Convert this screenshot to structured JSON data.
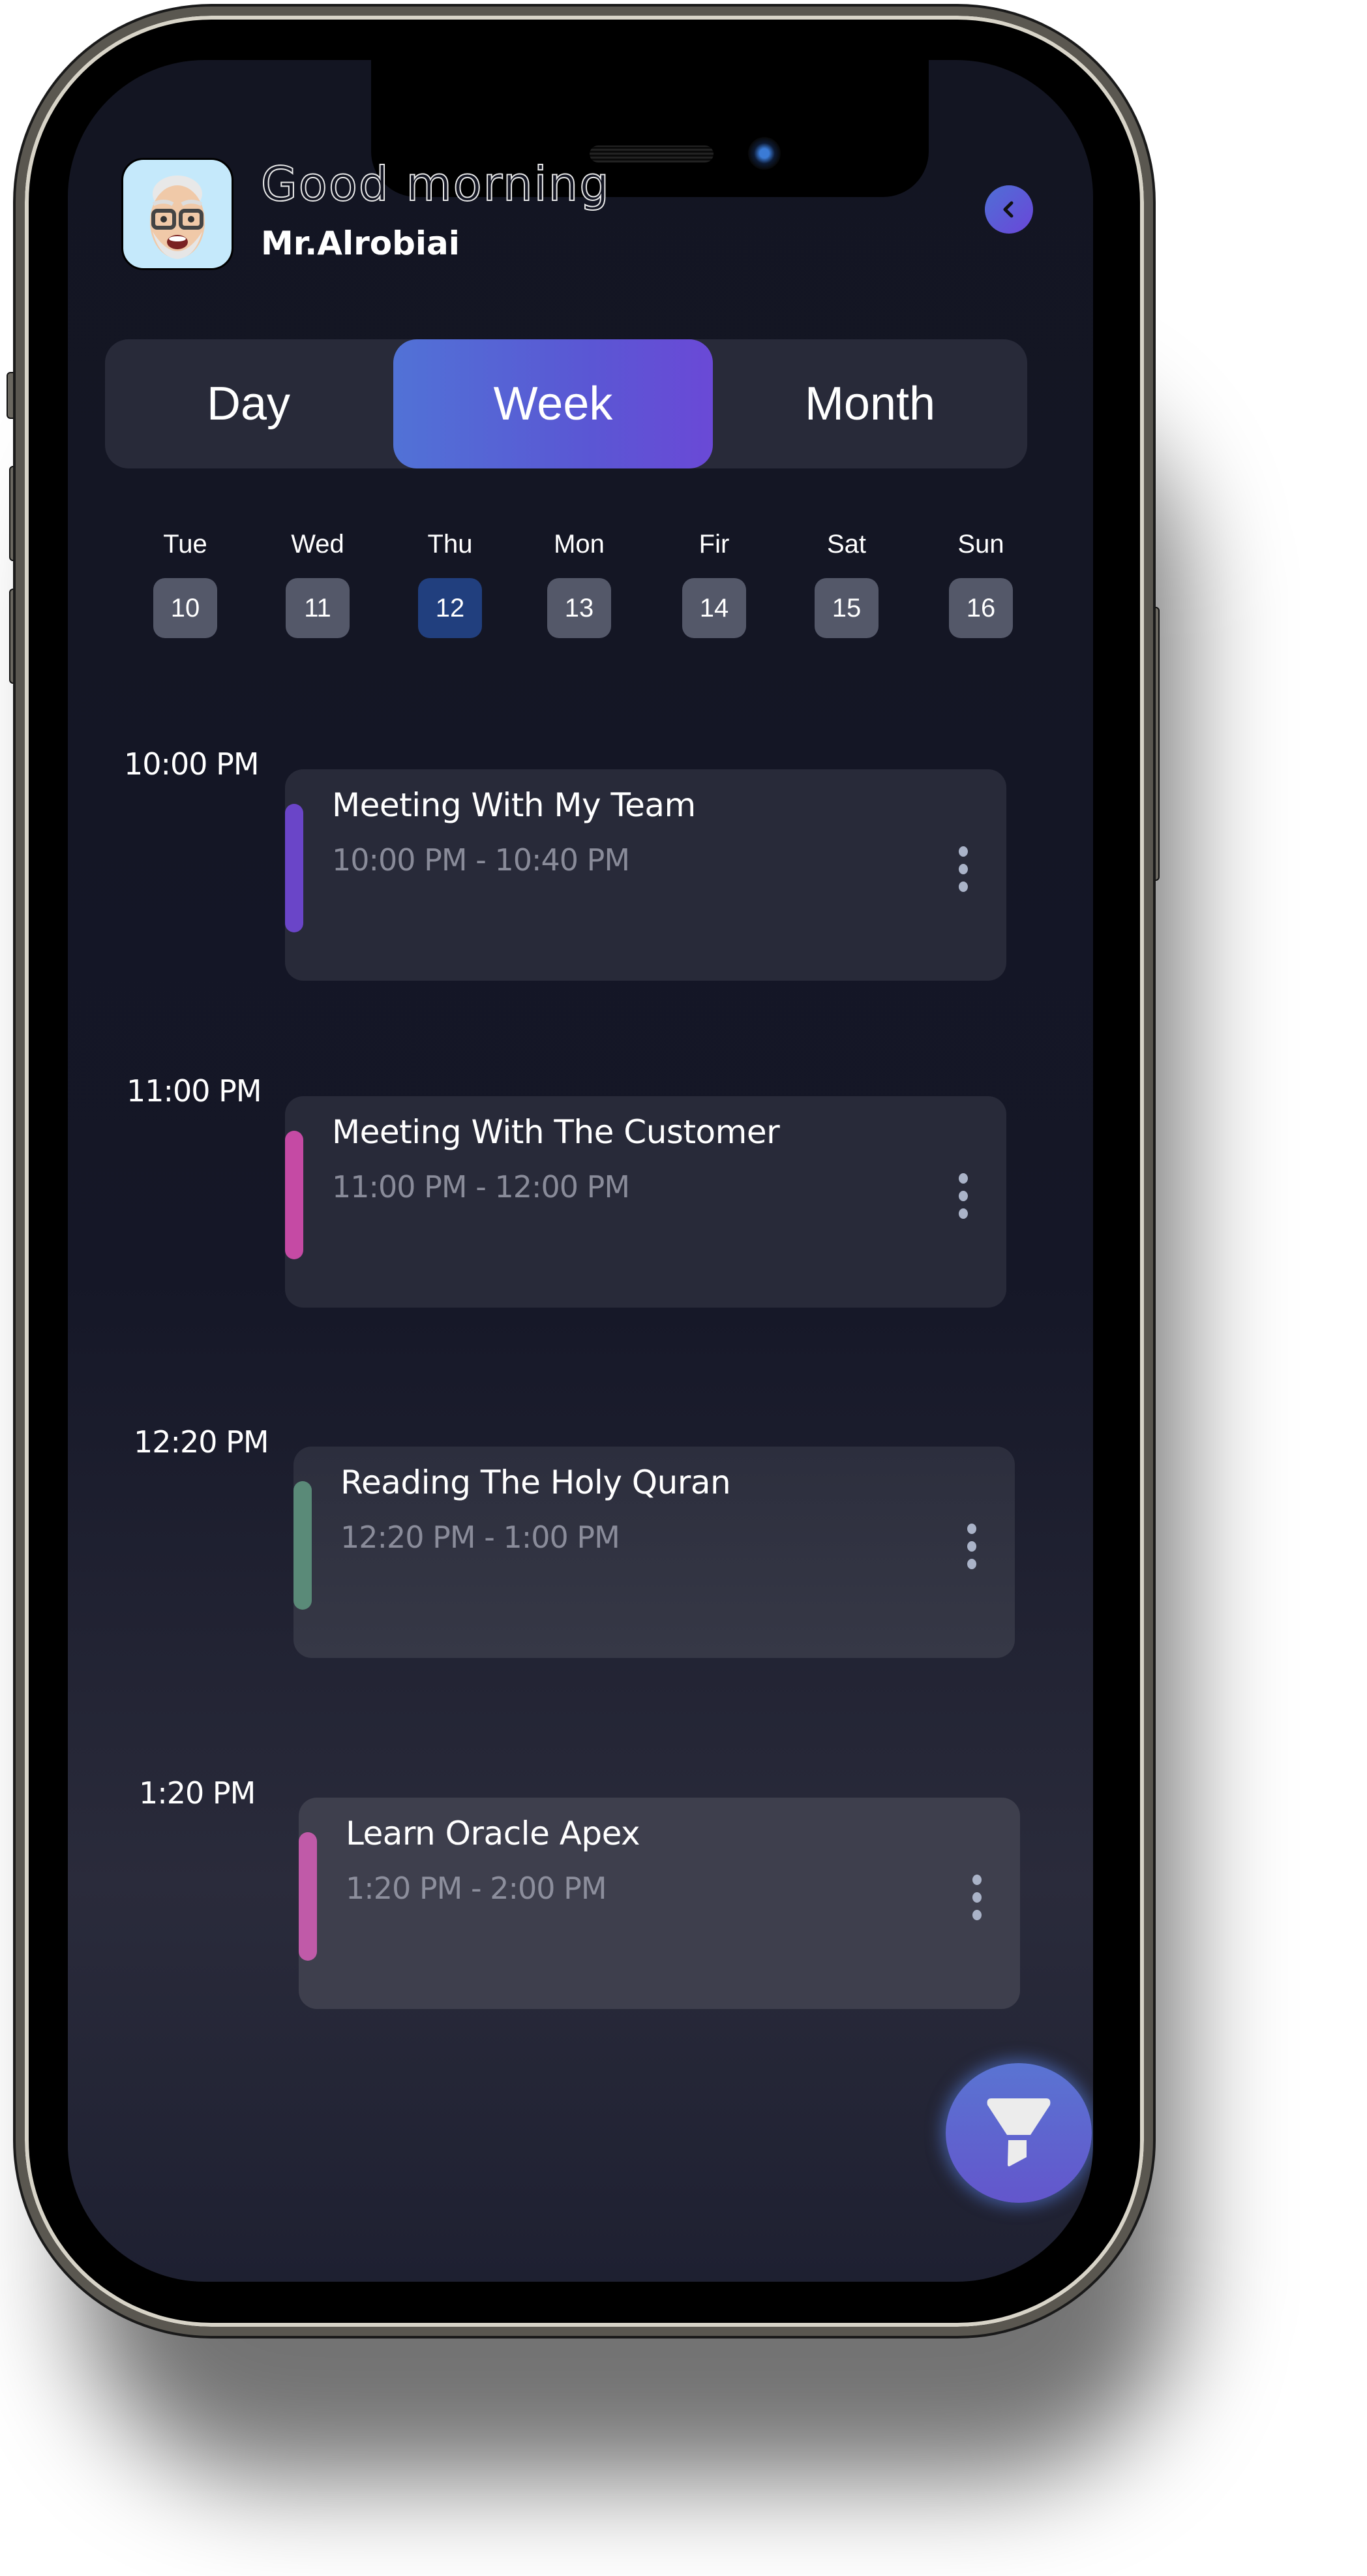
{
  "header": {
    "greeting": "Good  morning",
    "username": "Mr.Alrobiai",
    "avatar_icon": "memoji-avatar",
    "back_icon": "chevron-left-icon"
  },
  "view_tabs": [
    {
      "label": "Day",
      "active": false
    },
    {
      "label": "Week",
      "active": true
    },
    {
      "label": "Month",
      "active": false
    }
  ],
  "days": [
    {
      "name": "Tue",
      "num": "10",
      "selected": false
    },
    {
      "name": "Wed",
      "num": "11",
      "selected": false
    },
    {
      "name": "Thu",
      "num": "12",
      "selected": true
    },
    {
      "name": "Mon",
      "num": "13",
      "selected": false
    },
    {
      "name": "Fir",
      "num": "14",
      "selected": false
    },
    {
      "name": "Sat",
      "num": "15",
      "selected": false
    },
    {
      "name": "Sun",
      "num": "16",
      "selected": false
    }
  ],
  "events": [
    {
      "slot": "10:00 PM",
      "title": "Meeting With My Team",
      "time": "10:00 PM - 10:40 PM",
      "color": "#6a45c8"
    },
    {
      "slot": "11:00 PM",
      "title": "Meeting With The Customer",
      "time": "11:00 PM - 12:00 PM",
      "color": "#c54aa4"
    },
    {
      "slot": "12:20 PM",
      "title": "Reading The Holy Quran",
      "time": "12:20 PM - 1:00 PM",
      "color": "#5a8a78"
    },
    {
      "slot": "1:20 PM",
      "title": "Learn Oracle Apex",
      "time": "1:20 PM - 2:00 PM",
      "color": "#c05aa8"
    }
  ],
  "fab": {
    "icon": "filter-funnel-icon"
  },
  "colors": {
    "accent_start": "#5172d6",
    "accent_end": "#6a49d6",
    "selected_day": "#213f7e",
    "card_bg": "#282a39",
    "screen_bg": "#131522"
  }
}
